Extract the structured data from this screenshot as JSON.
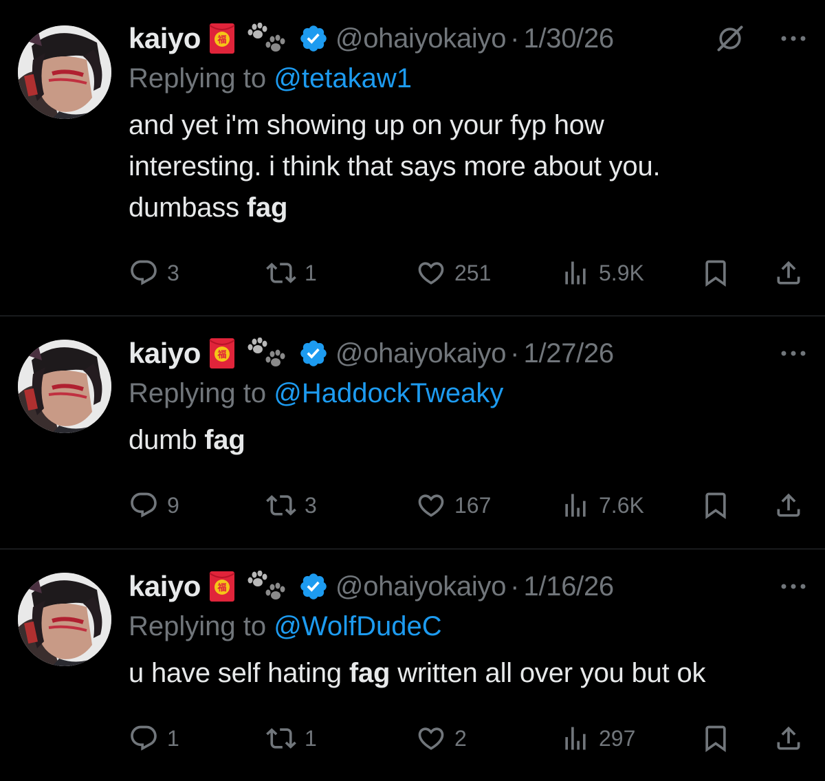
{
  "tweets": [
    {
      "display_name": "kaiyo",
      "handle": "@ohaiyokaiyo",
      "separator": "·",
      "date": "1/30/26",
      "replying_label": "Replying to",
      "replying_handle": "@tetakaw1",
      "body_lines": [
        "and yet i'm showing up on your fyp how",
        "interesting. i think that says more about you.",
        "dumbass "
      ],
      "body_bold": "fag",
      "replies": "3",
      "retweets": "1",
      "likes": "251",
      "views": "5.9K"
    },
    {
      "display_name": "kaiyo",
      "handle": "@ohaiyokaiyo",
      "separator": "·",
      "date": "1/27/26",
      "replying_label": "Replying to",
      "replying_handle": "@HaddockTweaky",
      "body_pre": "dumb ",
      "body_bold": "fag",
      "replies": "9",
      "retweets": "3",
      "likes": "167",
      "views": "7.6K"
    },
    {
      "display_name": "kaiyo",
      "handle": "@ohaiyokaiyo",
      "separator": "·",
      "date": "1/16/26",
      "replying_label": "Replying to",
      "replying_handle": "@WolfDudeC",
      "body_pre": "u have self hating ",
      "body_bold": "fag",
      "body_post": " written all over you but ok",
      "replies": "1",
      "retweets": "1",
      "likes": "2",
      "views": "297"
    }
  ],
  "icons": {
    "avatar": "avatar",
    "envelope": "red-envelope-emoji-icon",
    "paw": "paw-prints-icon",
    "verified": "verified-badge-icon",
    "grok": "grok-icon",
    "more": "more-icon",
    "reply": "reply-icon",
    "retweet": "retweet-icon",
    "like": "heart-icon",
    "views": "views-icon",
    "bookmark": "bookmark-icon",
    "share": "share-icon"
  },
  "colors": {
    "background": "#000000",
    "text": "#e7e9ea",
    "muted": "#71767b",
    "link": "#1d9bf0",
    "divider": "#2f3336",
    "envelope_red": "#e0243a",
    "envelope_gold": "#f5c518"
  }
}
